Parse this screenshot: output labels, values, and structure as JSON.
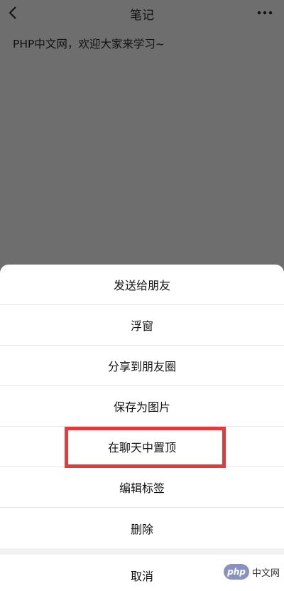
{
  "header": {
    "title": "笔记",
    "back_icon": "chevron-left-icon",
    "more_icon": "more-dots-icon"
  },
  "content": {
    "text": "PHP中文网，欢迎大家来学习~"
  },
  "sheet": {
    "items": [
      {
        "label": "发送给朋友"
      },
      {
        "label": "浮窗"
      },
      {
        "label": "分享到朋友圈"
      },
      {
        "label": "保存为图片"
      },
      {
        "label": "在聊天中置顶"
      },
      {
        "label": "编辑标签"
      },
      {
        "label": "删除"
      }
    ],
    "cancel_label": "取消"
  },
  "watermark": {
    "logo_text": "php",
    "text": "中文网"
  },
  "colors": {
    "overlay": "#6e6e6e",
    "sheet_bg": "#ffffff",
    "highlight": "#e23b3b"
  }
}
